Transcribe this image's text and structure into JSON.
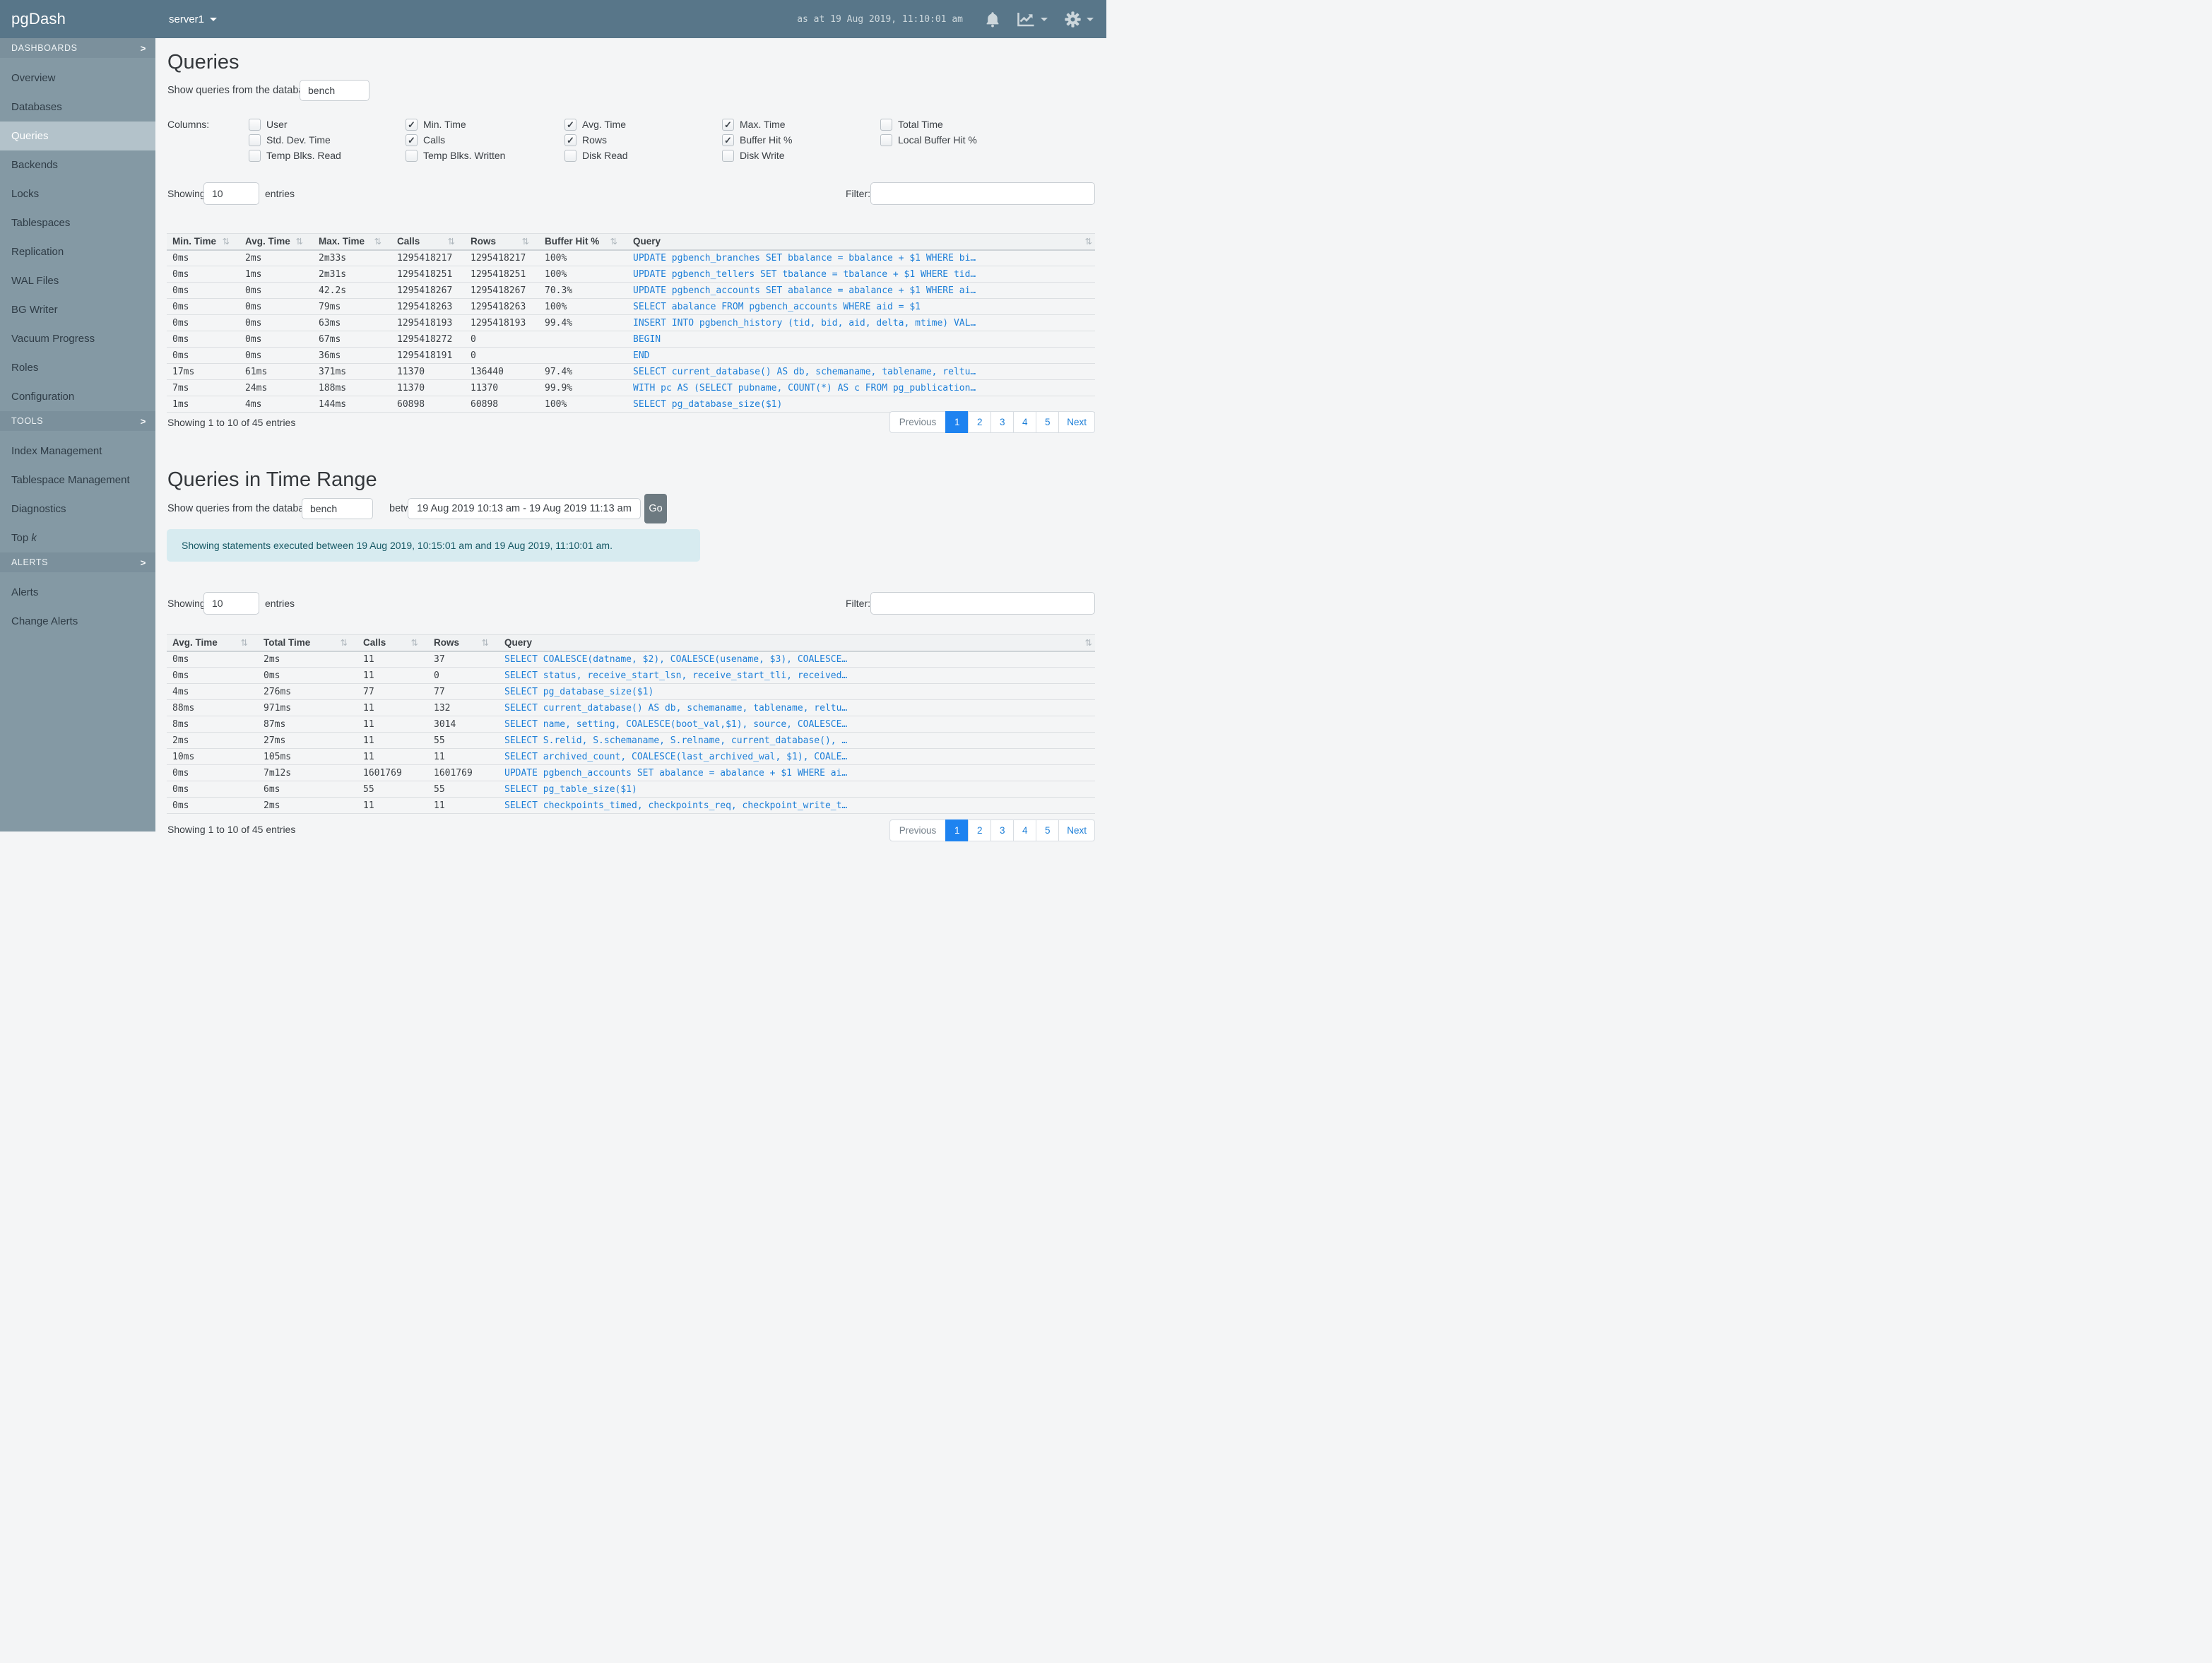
{
  "icons": {
    "check": "✓",
    "sort": "⇅",
    "chevron": ">"
  },
  "colors": {
    "topbar_bg": "#587689",
    "sidebar_bg": "#8499a4",
    "link_blue": "#1d7fd8",
    "active_page_bg": "#1e83f0",
    "alert_bg": "#d7ebf0",
    "alert_text": "#175965"
  },
  "topbar": {
    "brand": "pgDash",
    "server": "server1",
    "timestamp": "as at 19 Aug 2019, 11:10:01 am"
  },
  "sidebar": {
    "sections": [
      {
        "label": "DASHBOARDS",
        "items": [
          {
            "label": "Overview"
          },
          {
            "label": "Databases"
          },
          {
            "label": "Queries",
            "active": true
          },
          {
            "label": "Backends"
          },
          {
            "label": "Locks"
          },
          {
            "label": "Tablespaces"
          },
          {
            "label": "Replication"
          },
          {
            "label": "WAL Files"
          },
          {
            "label": "BG Writer"
          },
          {
            "label": "Vacuum Progress"
          },
          {
            "label": "Roles"
          },
          {
            "label": "Configuration"
          }
        ]
      },
      {
        "label": "TOOLS",
        "items": [
          {
            "label": "Index Management"
          },
          {
            "label": "Tablespace Management"
          },
          {
            "label": "Diagnostics"
          },
          {
            "label": "Top ",
            "em": "k"
          }
        ]
      },
      {
        "label": "ALERTS",
        "items": [
          {
            "label": "Alerts"
          },
          {
            "label": "Change Alerts"
          }
        ]
      }
    ]
  },
  "queries": {
    "title": "Queries",
    "db_label": "Show queries from the database:",
    "db_value": "bench",
    "columns_label": "Columns:",
    "column_groups": [
      [
        {
          "label": "User",
          "checked": false
        },
        {
          "label": "Std. Dev. Time",
          "checked": false
        },
        {
          "label": "Temp Blks. Read",
          "checked": false
        }
      ],
      [
        {
          "label": "Min. Time",
          "checked": true
        },
        {
          "label": "Calls",
          "checked": true
        },
        {
          "label": "Temp Blks. Written",
          "checked": false
        }
      ],
      [
        {
          "label": "Avg. Time",
          "checked": true
        },
        {
          "label": "Rows",
          "checked": true
        },
        {
          "label": "Disk Read",
          "checked": false
        }
      ],
      [
        {
          "label": "Max. Time",
          "checked": true
        },
        {
          "label": "Buffer Hit %",
          "checked": true
        },
        {
          "label": "Disk Write",
          "checked": false
        }
      ],
      [
        {
          "label": "Total Time",
          "checked": false
        },
        {
          "label": "Local Buffer Hit %",
          "checked": false
        }
      ]
    ],
    "showing_label": "Showing",
    "entries_value": "10",
    "entries_label": "entries",
    "filter_label": "Filter:",
    "filter_value": "",
    "table": {
      "headers": [
        "Min. Time",
        "Avg. Time",
        "Max. Time",
        "Calls",
        "Rows",
        "Buffer Hit %",
        "Query"
      ],
      "rows": [
        [
          "0ms",
          "2ms",
          "2m33s",
          "1295418217",
          "1295418217",
          "100%",
          "UPDATE pgbench_branches SET bbalance = bbalance + $1 WHERE bi…"
        ],
        [
          "0ms",
          "1ms",
          "2m31s",
          "1295418251",
          "1295418251",
          "100%",
          "UPDATE pgbench_tellers SET tbalance = tbalance + $1 WHERE tid…"
        ],
        [
          "0ms",
          "0ms",
          "42.2s",
          "1295418267",
          "1295418267",
          "70.3%",
          "UPDATE pgbench_accounts SET abalance = abalance + $1 WHERE ai…"
        ],
        [
          "0ms",
          "0ms",
          "79ms",
          "1295418263",
          "1295418263",
          "100%",
          "SELECT abalance FROM pgbench_accounts WHERE aid = $1"
        ],
        [
          "0ms",
          "0ms",
          "63ms",
          "1295418193",
          "1295418193",
          "99.4%",
          "INSERT INTO pgbench_history (tid, bid, aid, delta, mtime) VAL…"
        ],
        [
          "0ms",
          "0ms",
          "67ms",
          "1295418272",
          "0",
          "",
          "BEGIN"
        ],
        [
          "0ms",
          "0ms",
          "36ms",
          "1295418191",
          "0",
          "",
          "END"
        ],
        [
          "17ms",
          "61ms",
          "371ms",
          "11370",
          "136440",
          "97.4%",
          "SELECT current_database() AS db, schemaname, tablename, reltu…"
        ],
        [
          "7ms",
          "24ms",
          "188ms",
          "11370",
          "11370",
          "99.9%",
          "WITH pc AS (SELECT pubname, COUNT(*) AS c FROM pg_publication…"
        ],
        [
          "1ms",
          "4ms",
          "144ms",
          "60898",
          "60898",
          "100%",
          "SELECT pg_database_size($1)"
        ]
      ]
    },
    "summary": "Showing 1 to 10 of 45 entries",
    "pagination": {
      "prev": "Previous",
      "pages": [
        "1",
        "2",
        "3",
        "4",
        "5"
      ],
      "next": "Next",
      "active": "1"
    }
  },
  "time_range": {
    "title": "Queries in Time Range",
    "db_label": "Show queries from the database",
    "db_value": "bench",
    "between_label": "between",
    "range_value": "19 Aug 2019 10:13 am - 19 Aug 2019 11:13 am",
    "go_label": "Go",
    "alert_text": "Showing statements executed between 19 Aug 2019, 10:15:01 am and 19 Aug 2019, 11:10:01 am.",
    "showing_label": "Showing",
    "entries_value": "10",
    "entries_label": "entries",
    "filter_label": "Filter:",
    "filter_value": "",
    "table": {
      "headers": [
        "Avg. Time",
        "Total Time",
        "Calls",
        "Rows",
        "Query"
      ],
      "rows": [
        [
          "0ms",
          "2ms",
          "11",
          "37",
          "SELECT COALESCE(datname, $2), COALESCE(usename, $3), COALESCE…"
        ],
        [
          "0ms",
          "0ms",
          "11",
          "0",
          "SELECT status, receive_start_lsn, receive_start_tli, received…"
        ],
        [
          "4ms",
          "276ms",
          "77",
          "77",
          "SELECT pg_database_size($1)"
        ],
        [
          "88ms",
          "971ms",
          "11",
          "132",
          "SELECT current_database() AS db, schemaname, tablename, reltu…"
        ],
        [
          "8ms",
          "87ms",
          "11",
          "3014",
          "SELECT name, setting, COALESCE(boot_val,$1), source, COALESCE…"
        ],
        [
          "2ms",
          "27ms",
          "11",
          "55",
          "SELECT S.relid, S.schemaname, S.relname, current_database(), …"
        ],
        [
          "10ms",
          "105ms",
          "11",
          "11",
          "SELECT archived_count, COALESCE(last_archived_wal, $1), COALE…"
        ],
        [
          "0ms",
          "7m12s",
          "1601769",
          "1601769",
          "UPDATE pgbench_accounts SET abalance = abalance + $1 WHERE ai…"
        ],
        [
          "0ms",
          "6ms",
          "55",
          "55",
          "SELECT pg_table_size($1)"
        ],
        [
          "0ms",
          "2ms",
          "11",
          "11",
          "SELECT checkpoints_timed, checkpoints_req, checkpoint_write_t…"
        ]
      ]
    },
    "summary": "Showing 1 to 10 of 45 entries",
    "pagination": {
      "prev": "Previous",
      "pages": [
        "1",
        "2",
        "3",
        "4",
        "5"
      ],
      "next": "Next",
      "active": "1"
    }
  }
}
